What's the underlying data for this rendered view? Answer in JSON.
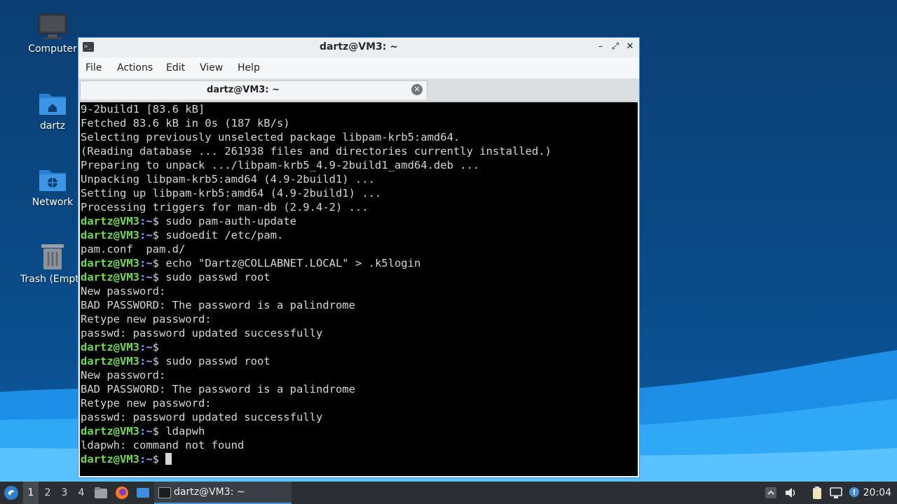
{
  "desktop": {
    "icons": [
      {
        "label": "Computer",
        "icon": "computer-icon"
      },
      {
        "label": "dartz",
        "icon": "home-folder-icon"
      },
      {
        "label": "Network",
        "icon": "network-folder-icon"
      },
      {
        "label": "Trash (Empty)",
        "icon": "trash-icon"
      }
    ]
  },
  "window": {
    "title": "dartz@VM3: ~",
    "menu": [
      "File",
      "Actions",
      "Edit",
      "View",
      "Help"
    ],
    "tab_label": "dartz@VM3: ~"
  },
  "terminal": {
    "prompt_user": "dartz@VM3",
    "prompt_path": ":~",
    "prompt_symbol": "$",
    "lines": [
      {
        "type": "out",
        "text": "9-2build1 [83.6 kB]"
      },
      {
        "type": "out",
        "text": "Fetched 83.6 kB in 0s (187 kB/s)"
      },
      {
        "type": "out",
        "text": "Selecting previously unselected package libpam-krb5:amd64."
      },
      {
        "type": "out",
        "text": "(Reading database ... 261938 files and directories currently installed.)"
      },
      {
        "type": "out",
        "text": "Preparing to unpack .../libpam-krb5_4.9-2build1_amd64.deb ..."
      },
      {
        "type": "out",
        "text": "Unpacking libpam-krb5:amd64 (4.9-2build1) ..."
      },
      {
        "type": "out",
        "text": "Setting up libpam-krb5:amd64 (4.9-2build1) ..."
      },
      {
        "type": "out",
        "text": "Processing triggers for man-db (2.9.4-2) ..."
      },
      {
        "type": "cmd",
        "text": " sudo pam-auth-update"
      },
      {
        "type": "cmd",
        "text": " sudoedit /etc/pam."
      },
      {
        "type": "out",
        "text": "pam.conf  pam.d/"
      },
      {
        "type": "cmd",
        "text": " echo \"Dartz@COLLABNET.LOCAL\" > .k5login"
      },
      {
        "type": "cmd",
        "text": " sudo passwd root"
      },
      {
        "type": "out",
        "text": "New password:"
      },
      {
        "type": "out",
        "text": "BAD PASSWORD: The password is a palindrome"
      },
      {
        "type": "out",
        "text": "Retype new password:"
      },
      {
        "type": "out",
        "text": "passwd: password updated successfully"
      },
      {
        "type": "cmd",
        "text": ""
      },
      {
        "type": "cmd",
        "text": " sudo passwd root"
      },
      {
        "type": "out",
        "text": "New password:"
      },
      {
        "type": "out",
        "text": "BAD PASSWORD: The password is a palindrome"
      },
      {
        "type": "out",
        "text": "Retype new password:"
      },
      {
        "type": "out",
        "text": "passwd: password updated successfully"
      },
      {
        "type": "cmd",
        "text": " ldapwh"
      },
      {
        "type": "out",
        "text": "ldapwh: command not found"
      },
      {
        "type": "cursor",
        "text": " "
      }
    ]
  },
  "taskbar": {
    "workspaces": [
      "1",
      "2",
      "3",
      "4"
    ],
    "active_workspace": "1",
    "task_label": "dartz@VM3: ~",
    "clock": "20:04"
  }
}
